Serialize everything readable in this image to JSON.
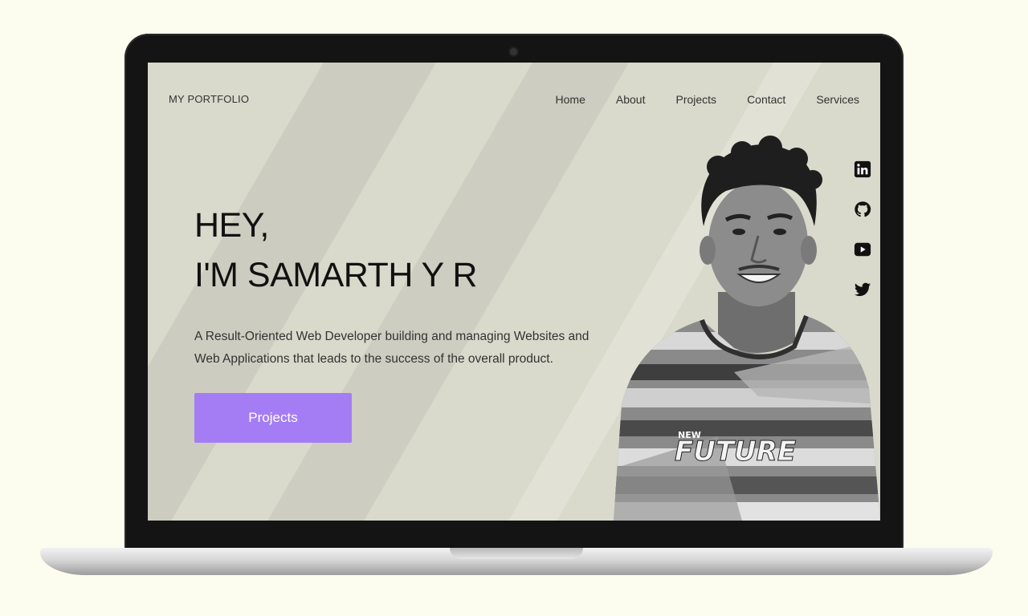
{
  "brand": "MY PORTFOLIO",
  "nav": [
    "Home",
    "About",
    "Projects",
    "Contact",
    "Services"
  ],
  "hero": {
    "line1": "HEY,",
    "line2": "I'M SAMARTH Y R",
    "description": "A Result-Oriented Web Developer building and managing Websites and Web Applications that leads to the success of the overall product.",
    "cta_label": "Projects"
  },
  "photo": {
    "shirt_text_small": "NEW",
    "shirt_text_big": "FUTURE"
  },
  "social": [
    "linkedin-icon",
    "github-icon",
    "youtube-icon",
    "twitter-icon"
  ],
  "colors": {
    "accent": "#a47df5",
    "screen_bg": "#d9d9cc",
    "page_bg": "#fcfdee"
  }
}
